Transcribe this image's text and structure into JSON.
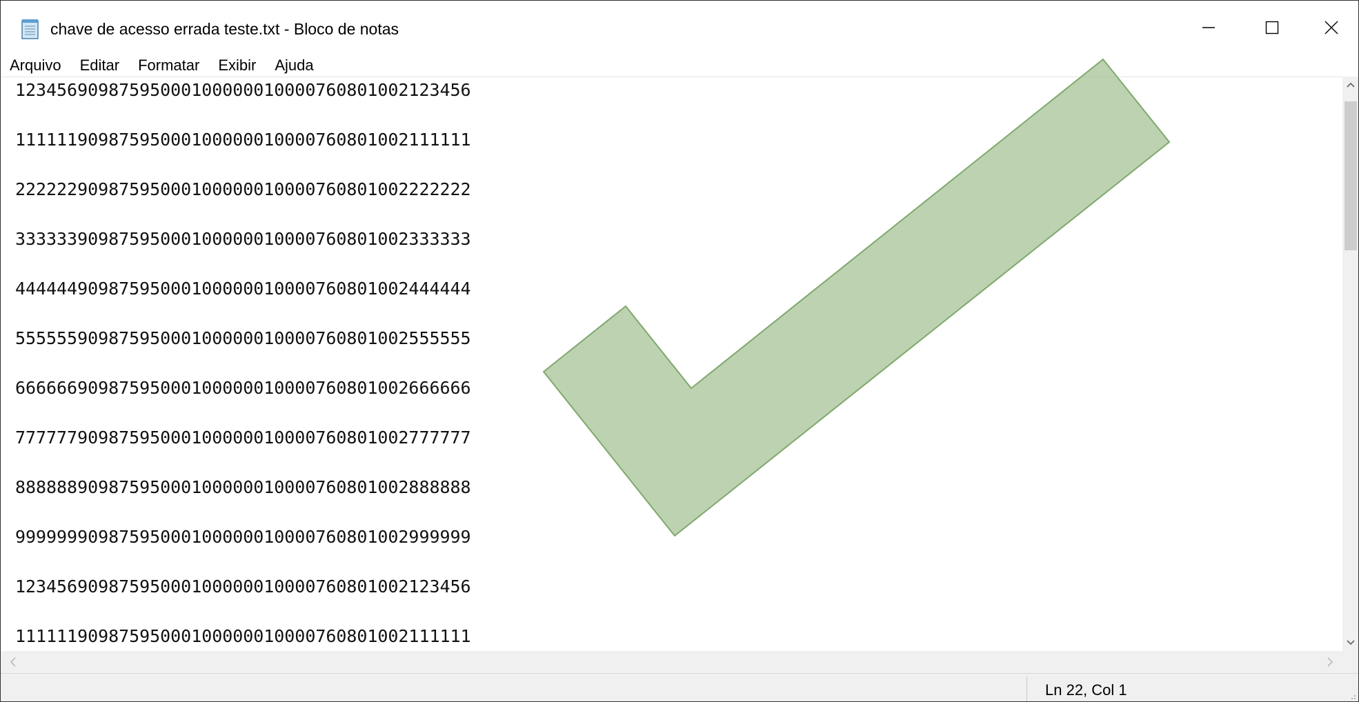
{
  "window": {
    "title": "chave de acesso errada teste.txt - Bloco de notas",
    "app_icon": "notepad-icon",
    "controls": [
      "minimize-icon",
      "maximize-icon",
      "close-icon"
    ]
  },
  "menu": {
    "items": [
      {
        "label": "Arquivo"
      },
      {
        "label": "Editar"
      },
      {
        "label": "Formatar"
      },
      {
        "label": "Exibir"
      },
      {
        "label": "Ajuda"
      }
    ]
  },
  "editor": {
    "lines": [
      "12345690987595000100000010000760801002123456",
      "11111190987595000100000010000760801002111111",
      "22222290987595000100000010000760801002222222",
      "33333390987595000100000010000760801002333333",
      "44444490987595000100000010000760801002444444",
      "55555590987595000100000010000760801002555555",
      "66666690987595000100000010000760801002666666",
      "77777790987595000100000010000760801002777777",
      "88888890987595000100000010000760801002888888",
      "99999990987595000100000010000760801002999999",
      "12345690987595000100000010000760801002123456",
      "11111190987595000100000010000760801002111111"
    ],
    "overlay": {
      "icon": "checkmark-icon",
      "fill": "#a9c59a",
      "stroke": "#7fa86c"
    }
  },
  "scrollbars": {
    "vertical": {
      "icons": [
        "chevron-up-icon",
        "chevron-down-icon"
      ]
    },
    "horizontal": {
      "icons": [
        "chevron-left-icon",
        "chevron-right-icon"
      ]
    }
  },
  "status": {
    "position": "Ln 22, Col 1"
  }
}
